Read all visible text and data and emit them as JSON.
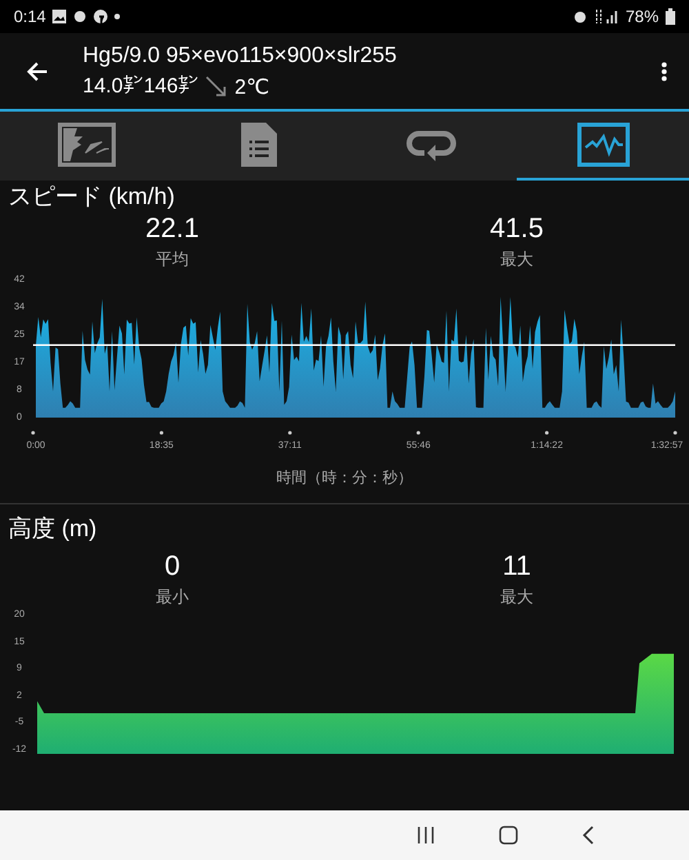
{
  "status_bar": {
    "time": "0:14",
    "battery": "78%"
  },
  "header": {
    "title": "Hg5/9.0 95×evo115×900×slr255",
    "size": "14.0㌢146㌢",
    "temperature": "2℃"
  },
  "tabs": [
    {
      "kind": "map",
      "selected": false
    },
    {
      "kind": "details",
      "selected": false
    },
    {
      "kind": "laps",
      "selected": false
    },
    {
      "kind": "graphs",
      "selected": true
    }
  ],
  "sections": [
    {
      "title": "スピード (km/h)",
      "kind": "speed",
      "stats": [
        {
          "value": "22.1",
          "label": "平均"
        },
        {
          "value": "41.5",
          "label": "最大"
        }
      ],
      "yticks": [
        "42",
        "34",
        "25",
        "17",
        "8",
        "0"
      ],
      "xticks": [
        "0:00",
        "18:35",
        "37:11",
        "55:46",
        "1:14:22",
        "1:32:57"
      ],
      "xlabel": "時間（時：分：秒）"
    },
    {
      "title": "高度 (m)",
      "kind": "altitude",
      "stats": [
        {
          "value": "0",
          "label": "最小"
        },
        {
          "value": "11",
          "label": "最大"
        }
      ],
      "yticks": [
        "20",
        "15",
        "9",
        "2",
        "-5",
        "-12"
      ]
    }
  ]
}
